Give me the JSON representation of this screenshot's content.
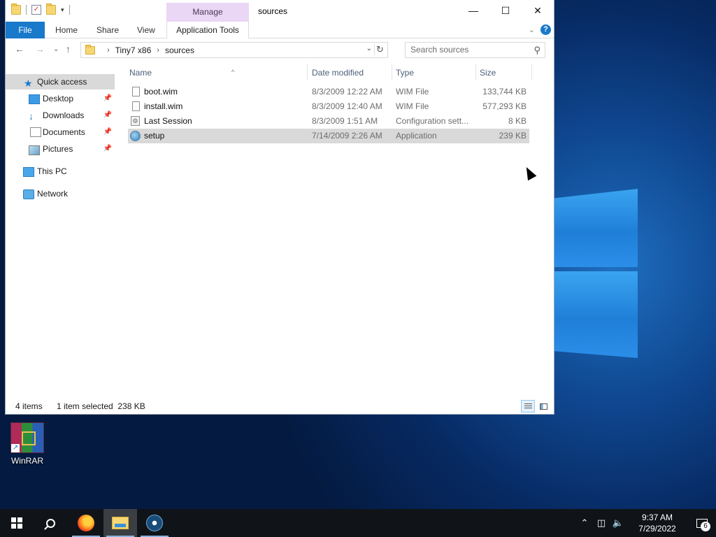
{
  "window": {
    "title": "sources",
    "contextual_group": "Manage",
    "tabs": [
      "File",
      "Home",
      "Share",
      "View",
      "Application Tools"
    ]
  },
  "address": {
    "crumbs": [
      "Tiny7 x86",
      "sources"
    ],
    "search_placeholder": "Search sources"
  },
  "nav_pane": {
    "items": [
      {
        "label": "Quick access"
      },
      {
        "label": "Desktop"
      },
      {
        "label": "Downloads"
      },
      {
        "label": "Documents"
      },
      {
        "label": "Pictures"
      },
      {
        "label": "This PC"
      },
      {
        "label": "Network"
      }
    ]
  },
  "columns": [
    "Name",
    "Date modified",
    "Type",
    "Size"
  ],
  "files": [
    {
      "name": "boot.wim",
      "date": "8/3/2009 12:22 AM",
      "type": "WIM File",
      "size": "133,744 KB",
      "icon": "file-icon"
    },
    {
      "name": "install.wim",
      "date": "8/3/2009 12:40 AM",
      "type": "WIM File",
      "size": "577,293 KB",
      "icon": "file-icon"
    },
    {
      "name": "Last Session",
      "date": "8/3/2009 1:51 AM",
      "type": "Configuration sett...",
      "size": "8 KB",
      "icon": "config-file-icon"
    },
    {
      "name": "setup",
      "date": "7/14/2009 2:26 AM",
      "type": "Application",
      "size": "239 KB",
      "icon": "setup-application-icon"
    }
  ],
  "status": {
    "count": "4 items",
    "selection": "1 item selected  238 KB"
  },
  "desktop": {
    "icon_label": "WinRAR"
  },
  "taskbar": {
    "time": "9:37 AM",
    "date": "7/29/2022",
    "notification_count": "6"
  },
  "colors": {
    "accent": "#1979ca",
    "manage_tab": "#ead6f5",
    "selection": "#d9d9d9",
    "taskbar": "#101418"
  }
}
